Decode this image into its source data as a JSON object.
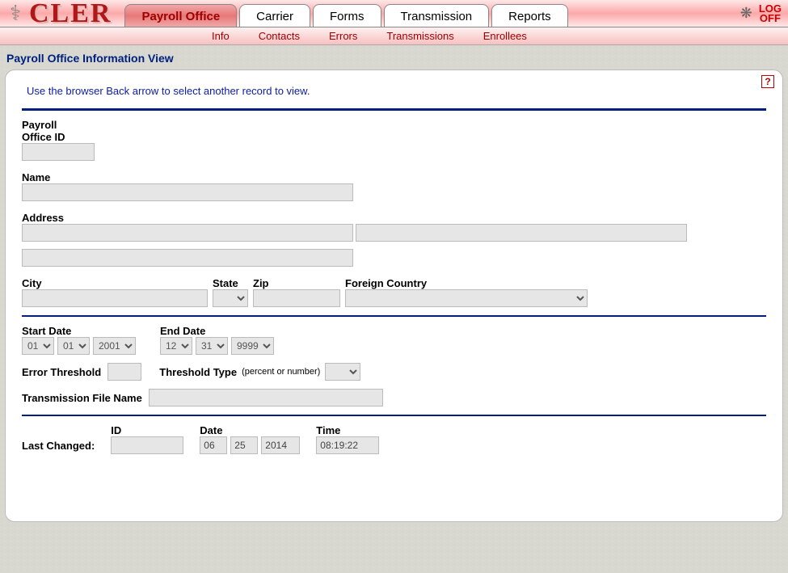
{
  "app": {
    "logo": "CLER"
  },
  "tabs": {
    "main": [
      "Payroll Office",
      "Carrier",
      "Forms",
      "Transmission",
      "Reports"
    ],
    "active_index": 0,
    "logoff": "LOG OFF"
  },
  "subnav": [
    "Info",
    "Contacts",
    "Errors",
    "Transmissions",
    "Enrollees"
  ],
  "page_title": "Payroll Office Information View",
  "hint": "Use the browser Back arrow to select another record to view.",
  "labels": {
    "payroll_office_id": "Payroll Office ID",
    "name": "Name",
    "address": "Address",
    "city": "City",
    "state": "State",
    "zip": "Zip",
    "foreign_country": "Foreign Country",
    "start_date": "Start Date",
    "end_date": "End Date",
    "error_threshold": "Error Threshold",
    "threshold_type": "Threshold Type",
    "threshold_type_note": "(percent or number)",
    "transmission_file_name": "Transmission File Name",
    "last_changed": "Last Changed:",
    "id": "ID",
    "date": "Date",
    "time": "Time"
  },
  "values": {
    "payroll_office_id": "",
    "name": "",
    "address1": "",
    "address2": "",
    "address3": "",
    "city": "",
    "state": "",
    "zip": "",
    "foreign_country": "",
    "start_mm": "01",
    "start_dd": "01",
    "start_yyyy": "2001",
    "end_mm": "12",
    "end_dd": "31",
    "end_yyyy": "9999",
    "error_threshold": "",
    "threshold_type": "",
    "transmission_file_name": "",
    "last_id": "",
    "last_date_mm": "06",
    "last_date_dd": "25",
    "last_date_yyyy": "2014",
    "last_time": "08:19:22"
  }
}
